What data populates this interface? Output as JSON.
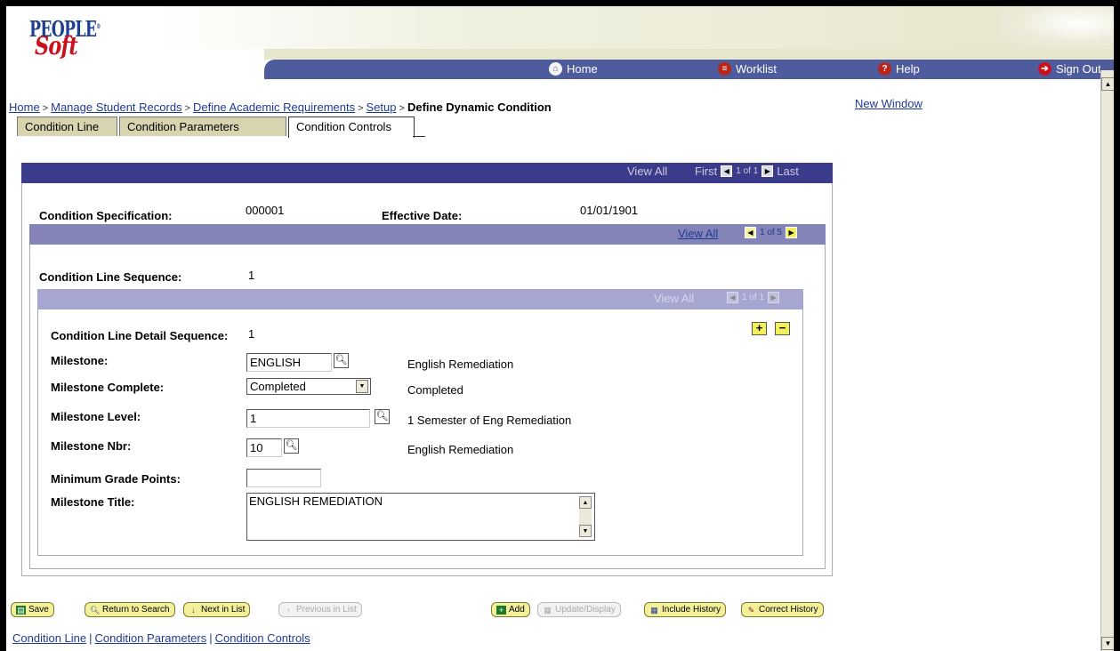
{
  "app": {
    "logo_line1": "PEOPLE",
    "logo_line2": "Soft",
    "logo_tm": "®"
  },
  "nav": {
    "home": "Home",
    "worklist": "Worklist",
    "help": "Help",
    "signout": "Sign Out"
  },
  "breadcrumb": {
    "items": [
      "Home",
      "Manage Student Records",
      "Define Academic Requirements",
      "Setup"
    ],
    "current": "Define Dynamic Condition",
    "separator": ">"
  },
  "new_window": "New Window",
  "tabs": [
    {
      "label": "Condition Line"
    },
    {
      "label": "Condition Parameters"
    },
    {
      "label": "Condition Controls"
    }
  ],
  "outer_bar": {
    "view_all": "View All",
    "first": "First",
    "position": "1 of 1",
    "last": "Last"
  },
  "header_fields": {
    "condition_spec_label": "Condition Specification:",
    "condition_spec_value": "000001",
    "effective_date_label": "Effective Date:",
    "effective_date_value": "01/01/1901"
  },
  "mid_bar": {
    "view_all": "View All",
    "position": "1 of 5"
  },
  "line_sequence": {
    "label": "Condition Line Sequence:",
    "value": "1"
  },
  "inner_bar": {
    "view_all": "View All",
    "position": "1 of 1"
  },
  "detail": {
    "detail_seq_label": "Condition Line Detail Sequence:",
    "detail_seq_value": "1",
    "milestone_label": "Milestone:",
    "milestone_value": "ENGLISH",
    "milestone_desc": "English Remediation",
    "complete_label": "Milestone Complete:",
    "complete_value": "Completed",
    "complete_desc": "Completed",
    "level_label": "Milestone Level:",
    "level_value": "1",
    "level_desc": "1 Semester of Eng Remediation",
    "nbr_label": "Milestone Nbr:",
    "nbr_value": "10",
    "nbr_desc": "English Remediation",
    "min_grade_label": "Minimum Grade Points:",
    "min_grade_value": "",
    "title_label": "Milestone Title:",
    "title_value": "ENGLISH REMEDIATION"
  },
  "toolbar": {
    "save": "Save",
    "return_to_search": "Return to Search",
    "next_in_list": "Next in List",
    "previous_in_list": "Previous in List",
    "add": "Add",
    "update_display": "Update/Display",
    "include_history": "Include History",
    "correct_history": "Correct History"
  },
  "footer_links": [
    "Condition Line",
    "Condition Parameters",
    "Condition Controls"
  ],
  "colors": {
    "nav_bar": "#4e5b9c",
    "outer_bar": "#3b3b8c",
    "mid_bar": "#8484b8",
    "inner_bar": "#a6a6d0",
    "button_fill": "#f4f09a",
    "link": "#1f3a93"
  }
}
